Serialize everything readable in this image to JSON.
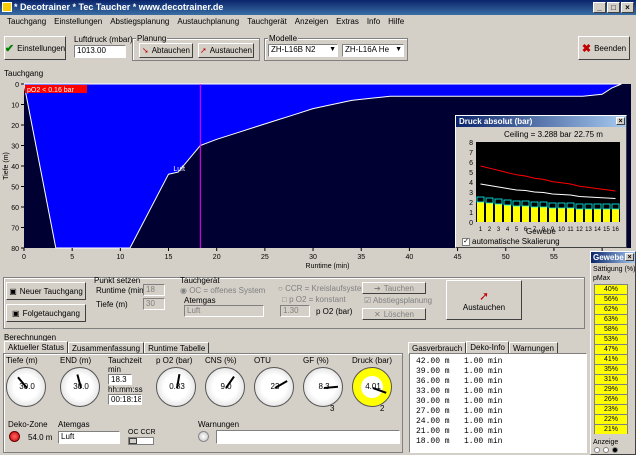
{
  "window": {
    "title": "* Decotrainer * Tec Taucher * www.decotrainer.de"
  },
  "menu": [
    "Tauchgang",
    "Einstellungen",
    "Abstiegsplanung",
    "Austauchplanung",
    "Tauchgerät",
    "Anzeigen",
    "Extras",
    "Info",
    "Hilfe"
  ],
  "toolbar": {
    "settings_button": "Einstellungen",
    "pressure_label": "Luftdruck (mbar)",
    "pressure_value": "1013.00",
    "planning_label": "Planung",
    "descend_button": "Abtauchen",
    "ascend_button": "Austauchen",
    "models_label": "Modelle",
    "model_n2": "ZH-L16B N2",
    "model_he": "ZH-L16A He",
    "exit_button": "Beenden"
  },
  "profile": {
    "group_label": "Tauchgang",
    "warning": "pO2 < 0.16 bar",
    "ylabel": "Tiefe (m)",
    "xlabel": "Runtime (min)",
    "yticks": [
      "0",
      "10",
      "20",
      "30",
      "40",
      "50",
      "60",
      "70",
      "80"
    ],
    "xticks": [
      "0",
      "5",
      "10",
      "15",
      "20",
      "25",
      "30",
      "35",
      "40",
      "45",
      "50",
      "55",
      "60"
    ],
    "marker_label": "Luft",
    "colors": {
      "bg": "#000033",
      "fill": "#0000ff",
      "line": "#ffffff",
      "marker": "#ff00ff",
      "warning": "#ff0000"
    }
  },
  "pressure_window": {
    "title": "Druck absolut (bar)",
    "ceiling": "Ceiling = 3.288 bar",
    "depth": "22.75 m",
    "yticks": [
      "8",
      "7",
      "6",
      "5",
      "4",
      "3",
      "2",
      "1",
      "0"
    ],
    "xticks": [
      "1",
      "2",
      "3",
      "4",
      "5",
      "6",
      "7",
      "8",
      "9",
      "10",
      "11",
      "12",
      "13",
      "14",
      "15",
      "16"
    ],
    "xlabel": "Gewebe",
    "auto_scale": "automatische Skalierung",
    "bars": [
      2.0,
      1.9,
      1.8,
      1.7,
      1.6,
      1.6,
      1.5,
      1.5,
      1.4,
      1.4,
      1.4,
      1.3,
      1.3,
      1.3,
      1.3,
      1.3
    ],
    "colors": {
      "bg": "#000000",
      "yellow": "#ffff00",
      "red": "#ff0000",
      "cyan": "#00ffff",
      "white": "#ffffff"
    }
  },
  "gewebe": {
    "title": "Gewebe",
    "saturation_label": "Sättigung (%)",
    "pmax_label": "pMax",
    "values": [
      "40%",
      "56%",
      "62%",
      "63%",
      "58%",
      "53%",
      "47%",
      "41%",
      "35%",
      "31%",
      "29%",
      "26%",
      "23%",
      "22%",
      "21%"
    ],
    "display_label": "Anzeige"
  },
  "controls": {
    "new_dive": "Neuer Tauchgang",
    "next_dive": "Folgetauchgang",
    "points_label": "Punkt setzen",
    "runtime_label": "Runtime (min)",
    "runtime_value": "18",
    "depth_label": "Tiefe (m)",
    "depth_value": "30",
    "gear_label": "Tauchgerät",
    "oc_label": "OC = offenes System",
    "gas_label": "Atemgas",
    "gas_value": "Luft",
    "ccr_label": "CCR = Kreislaufsystem",
    "po2_const": "p O2 = konstant",
    "po2_value": "1.30",
    "po2_unit": "p O2 (bar)",
    "dive_button": "Tauchen",
    "descent_plan": "Abstiegsplanung",
    "delete_button": "Löschen",
    "ascend_big": "Austauchen"
  },
  "calc": {
    "title": "Berechnungen",
    "tabs": [
      "Aktueller Status",
      "Zusammenfassung",
      "Runtime Tabelle"
    ],
    "gauges": [
      {
        "label": "Tiefe (m)",
        "value": "30.0"
      },
      {
        "label": "END (m)",
        "value": "30.0"
      },
      {
        "label": "p O2 (bar)",
        "value": "0.83"
      },
      {
        "label": "CNS (%)",
        "value": "9.0"
      },
      {
        "label": "OTU",
        "value": "23"
      },
      {
        "label": "GF (%)",
        "value": "8.3"
      },
      {
        "label": "Druck (bar)",
        "value": "4.01"
      }
    ],
    "divetime_label": "Tauchzeit",
    "divetime_min": "min",
    "divetime_value": "18.3",
    "divetime_fmt": "hh:mm:ss",
    "divetime_hms": "00:18:18",
    "gf_sub": "3",
    "druck_sub": "2",
    "deko_label": "Deko-Zone",
    "deko_value": "54.0 m",
    "atemgas_label": "Atemgas",
    "atemgas_value": "Luft",
    "occcr_label": "OC CCR",
    "warnings_label": "Warnungen"
  },
  "gas_tabs": [
    "Gasverbrauch",
    "Deko-Info",
    "Warnungen"
  ],
  "deko_table": [
    "42.00 m   1.00 min",
    "39.00 m   1.00 min",
    "36.00 m   1.00 min",
    "33.00 m   1.00 min",
    "30.00 m   1.00 min",
    "27.00 m   1.00 min",
    "24.00 m   1.00 min",
    "21.00 m   1.00 min",
    "18.00 m   1.00 min"
  ]
}
